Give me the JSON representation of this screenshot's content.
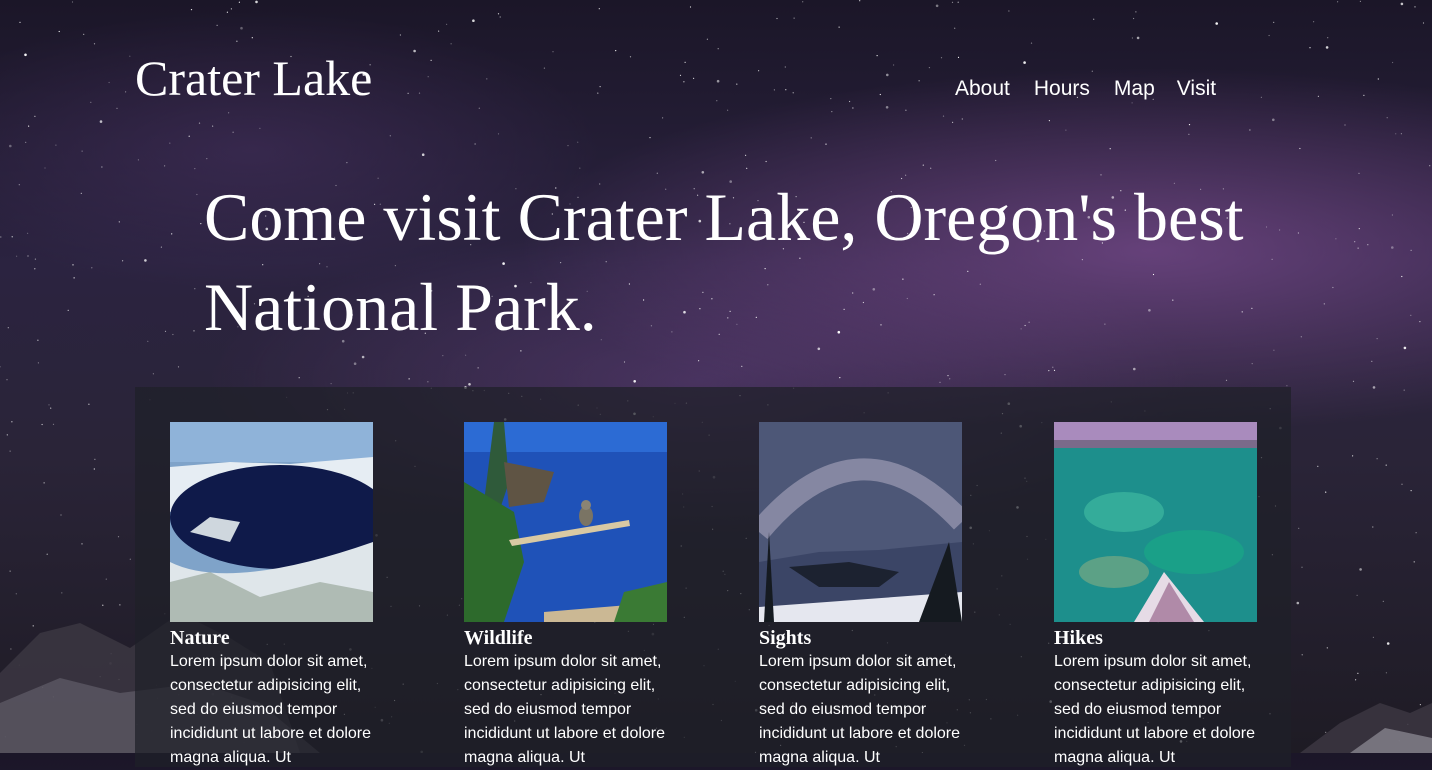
{
  "site": {
    "title": "Crater Lake"
  },
  "nav": {
    "items": [
      "About",
      "Hours",
      "Map",
      "Visit"
    ]
  },
  "hero": {
    "headline": "Come visit Crater Lake, Oregon's best National Park."
  },
  "cards": [
    {
      "title": "Nature",
      "text": "Lorem ipsum dolor sit amet, consectetur adipisicing elit, sed do eiusmod tempor incididunt ut labore et dolore magna aliqua. Ut"
    },
    {
      "title": "Wildlife",
      "text": "Lorem ipsum dolor sit amet, consectetur adipisicing elit, sed do eiusmod tempor incididunt ut labore et dolore magna aliqua. Ut"
    },
    {
      "title": "Sights",
      "text": "Lorem ipsum dolor sit amet, consectetur adipisicing elit, sed do eiusmod tempor incididunt ut labore et dolore magna aliqua. Ut"
    },
    {
      "title": "Hikes",
      "text": "Lorem ipsum dolor sit amet, consectetur adipisicing elit, sed do eiusmod tempor incididunt ut labore et dolore magna aliqua. Ut"
    }
  ],
  "colors": {
    "text": "#ffffff",
    "panel": "#1e2028",
    "sky": "#2b2340"
  }
}
